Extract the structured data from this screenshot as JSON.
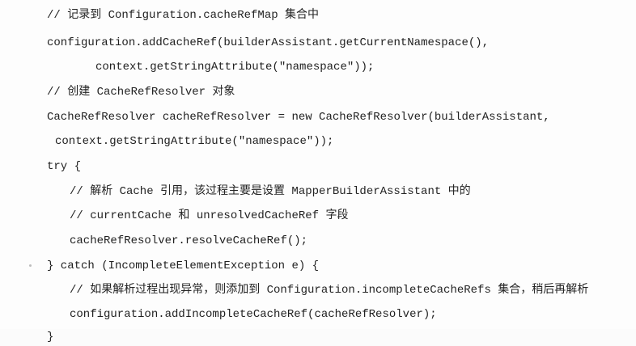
{
  "code_lines": [
    "// 记录到 Configuration.cacheRefMap 集合中",
    "configuration.addCacheRef(builderAssistant.getCurrentNamespace(),",
    "context.getStringAttribute(\"namespace\"));",
    "// 创建 CacheRefResolver 对象",
    "CacheRefResolver cacheRefResolver = new CacheRefResolver(builderAssistant,",
    "context.getStringAttribute(\"namespace\"));",
    "try {",
    "// 解析 Cache 引用，该过程主要是设置 MapperBuilderAssistant 中的",
    "// currentCache 和 unresolvedCacheRef 字段",
    "cacheRefResolver.resolveCacheRef();",
    "} catch (IncompleteElementException e) {",
    "// 如果解析过程出现异常，则添加到 Configuration.incompleteCacheRefs 集合，稍后再解析",
    "configuration.addIncompleteCacheRef(cacheRefResolver);",
    "}"
  ]
}
